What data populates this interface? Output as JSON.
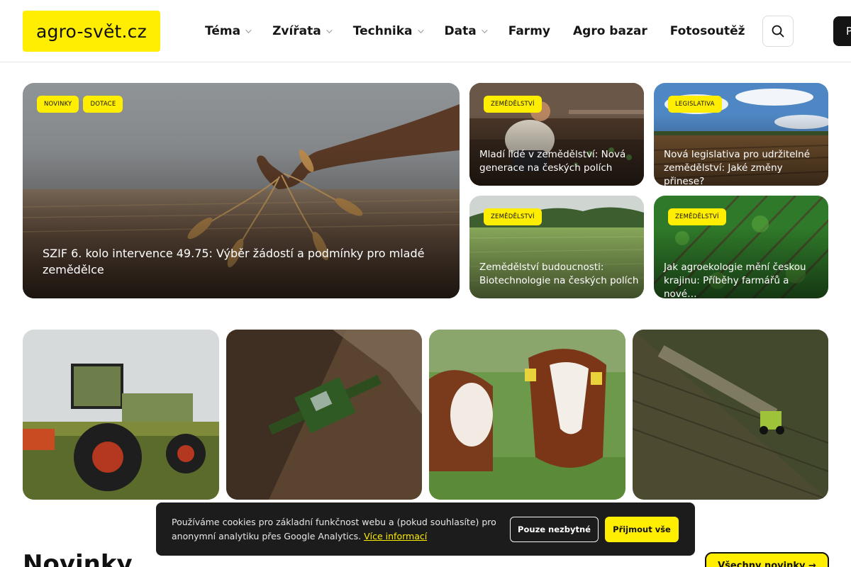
{
  "site": {
    "logo": "agro-svět.cz",
    "cta_partial": "P"
  },
  "nav": [
    {
      "label": "Téma",
      "dropdown": true
    },
    {
      "label": "Zvířata",
      "dropdown": true
    },
    {
      "label": "Technika",
      "dropdown": true
    },
    {
      "label": "Data",
      "dropdown": true
    },
    {
      "label": "Farmy",
      "dropdown": false
    },
    {
      "label": "Agro bazar",
      "dropdown": false
    },
    {
      "label": "Fotosoutěž",
      "dropdown": false
    }
  ],
  "featured": {
    "tags": [
      "NOVINKY",
      "DOTACE"
    ],
    "title": "SZIF 6. kolo intervence 49.75: Výběr žádostí a podmínky pro mladé zemědělce"
  },
  "side_articles": [
    {
      "tag": "ZEMĚDĚLSTVÍ",
      "title": "Mladí lidé v zemědělství: Nová generace na českých polích"
    },
    {
      "tag": "LEGISLATIVA",
      "title": "Nová legislativa pro udržitelné zemědělství: Jaké změny přinese?"
    },
    {
      "tag": "ZEMĚDĚLSTVÍ",
      "title": "Zemědělství budoucnosti: Biotechnologie na českých polích"
    },
    {
      "tag": "ZEMĚDĚLSTVÍ",
      "title": "Jak agroekologie mění českou krajinu: Příběhy farmářů a nové…"
    }
  ],
  "cookie": {
    "text": "Používáme cookies pro základní funkčnost webu a (pokud souhlasíte) pro anonymní analytiku přes Google Analytics.",
    "more": "Více informací",
    "necessary": "Pouze nezbytné",
    "accept": "Přijmout vše"
  },
  "news": {
    "heading": "Novinky",
    "all_button": "Všechny novinky →"
  },
  "colors": {
    "accent": "#ffee00",
    "dark": "#1c1c1c"
  }
}
